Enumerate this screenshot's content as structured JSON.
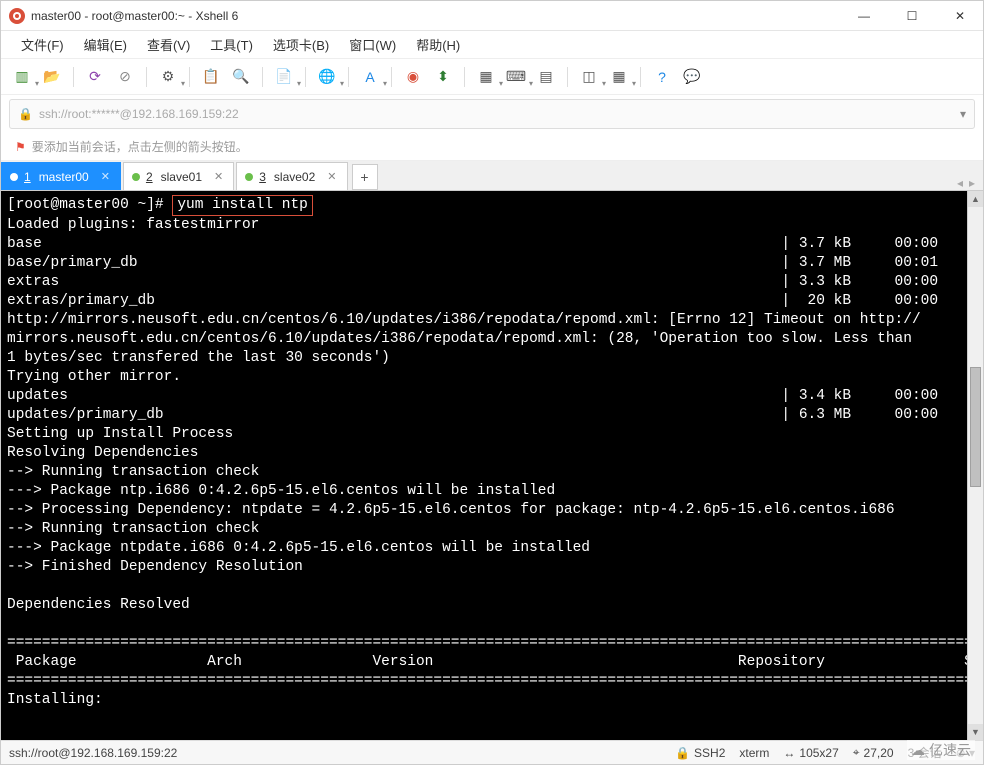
{
  "window": {
    "title": "master00 - root@master00:~ - Xshell 6"
  },
  "menu": {
    "file": "文件(F)",
    "edit": "编辑(E)",
    "view": "查看(V)",
    "tools": "工具(T)",
    "tabs": "选项卡(B)",
    "window": "窗口(W)",
    "help": "帮助(H)"
  },
  "address": {
    "text": "ssh://root:******@192.168.169.159:22"
  },
  "hint": {
    "text": "要添加当前会话，点击左侧的箭头按钮。"
  },
  "tabs": [
    {
      "num": "1",
      "label": "master00",
      "active": true
    },
    {
      "num": "2",
      "label": "slave01",
      "active": false
    },
    {
      "num": "3",
      "label": "slave02",
      "active": false
    }
  ],
  "terminal": {
    "prompt": "[root@master00 ~]# ",
    "command": "yum install ntp",
    "lines": [
      "Loaded plugins: fastestmirror",
      "base                                                                                     | 3.7 kB     00:00",
      "base/primary_db                                                                          | 3.7 MB     00:01",
      "extras                                                                                   | 3.3 kB     00:00",
      "extras/primary_db                                                                        |  20 kB     00:00",
      "http://mirrors.neusoft.edu.cn/centos/6.10/updates/i386/repodata/repomd.xml: [Errno 12] Timeout on http://",
      "mirrors.neusoft.edu.cn/centos/6.10/updates/i386/repodata/repomd.xml: (28, 'Operation too slow. Less than",
      "1 bytes/sec transfered the last 30 seconds')",
      "Trying other mirror.",
      "updates                                                                                  | 3.4 kB     00:00",
      "updates/primary_db                                                                       | 6.3 MB     00:00",
      "Setting up Install Process",
      "Resolving Dependencies",
      "--> Running transaction check",
      "---> Package ntp.i686 0:4.2.6p5-15.el6.centos will be installed",
      "--> Processing Dependency: ntpdate = 4.2.6p5-15.el6.centos for package: ntp-4.2.6p5-15.el6.centos.i686",
      "--> Running transaction check",
      "---> Package ntpdate.i686 0:4.2.6p5-15.el6.centos will be installed",
      "--> Finished Dependency Resolution",
      "",
      "Dependencies Resolved",
      "",
      "========================================================================================================================",
      " Package               Arch               Version                                   Repository                Size",
      "========================================================================================================================",
      "Installing:"
    ]
  },
  "status": {
    "addr": "ssh://root@192.168.169.159:22",
    "proto": "SSH2",
    "term": "xterm",
    "size": "105x27",
    "pos": "27,20",
    "sessions": "3 会话"
  },
  "watermark": "亿速云"
}
